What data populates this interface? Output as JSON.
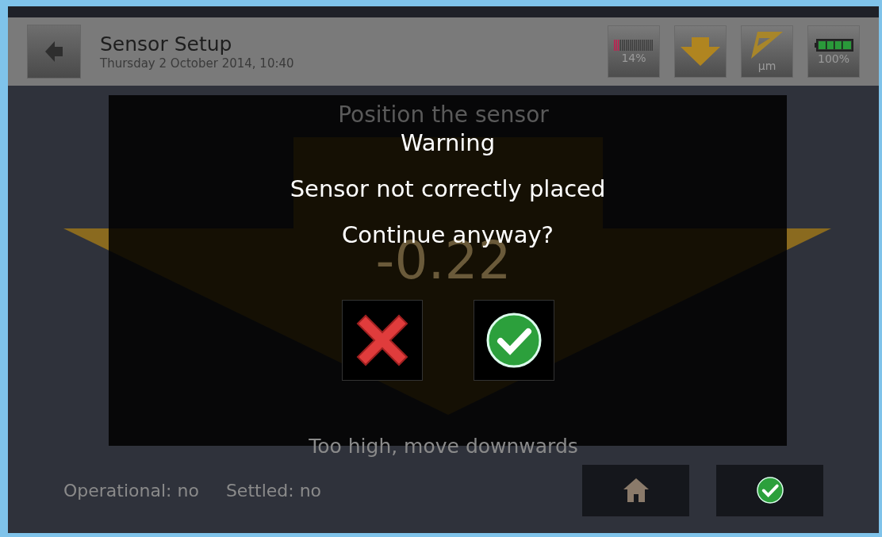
{
  "header": {
    "title": "Sensor Setup",
    "date": "Thursday 2 October 2014, 10:40",
    "indicators": [
      {
        "kind": "meter",
        "label": "14%",
        "level": 0.14
      },
      {
        "kind": "arrow"
      },
      {
        "kind": "ruler",
        "label": "µm"
      },
      {
        "kind": "battery",
        "label": "100%",
        "level": 1
      }
    ]
  },
  "background": {
    "instruction": "Position the sensor",
    "reading": "-0.22",
    "hint": "Too high, move downwards"
  },
  "dialog": {
    "lines": [
      "Warning",
      "Sensor not correctly placed",
      "Continue anyway?"
    ],
    "buttons": [
      {
        "kind": "cancel"
      },
      {
        "kind": "confirm"
      }
    ]
  },
  "footer": {
    "status": [
      "Operational: no",
      "Settled: no"
    ],
    "buttons": [
      {
        "kind": "home"
      },
      {
        "kind": "confirm"
      }
    ]
  }
}
